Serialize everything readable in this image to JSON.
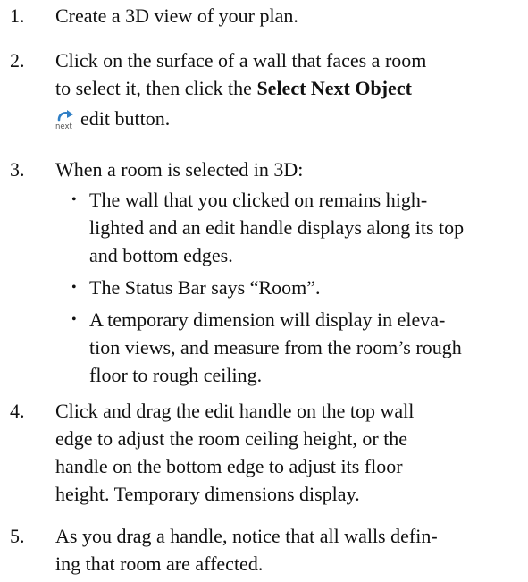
{
  "steps": [
    {
      "number": "1.",
      "lines": [
        "Create a 3D view of your plan."
      ]
    },
    {
      "number": "2.",
      "line1": "Click on the surface of a wall that faces a room",
      "line2_prefix": "to select it, then click the ",
      "line2_bold": "Select Next Object",
      "icon": "select-next-object-icon",
      "icon_label": "next",
      "line3_suffix": "edit button."
    },
    {
      "number": "3.",
      "lines": [
        "When a room is selected in 3D:"
      ],
      "bullets": [
        {
          "lines": [
            "The wall that you clicked on remains high-",
            "lighted and an edit handle displays along its top",
            "and bottom edges."
          ]
        },
        {
          "lines": [
            "The Status Bar says “Room”."
          ]
        },
        {
          "lines": [
            "A temporary dimension will display in eleva-",
            "tion views, and measure from the room’s rough",
            "floor to rough ceiling."
          ]
        }
      ]
    },
    {
      "number": "4.",
      "lines": [
        "Click and drag the edit handle on the top wall",
        "edge to adjust the room ceiling height, or the",
        "handle on the bottom edge to adjust its floor",
        "height. Temporary dimensions display."
      ]
    },
    {
      "number": "5.",
      "lines": [
        "As you drag a handle, notice that all walls defin-",
        "ing that room are affected."
      ]
    }
  ],
  "bullet_glyph": "•",
  "colors": {
    "text": "#111111",
    "icon_arrow": "#2f7fc6",
    "icon_label": "#555555"
  }
}
